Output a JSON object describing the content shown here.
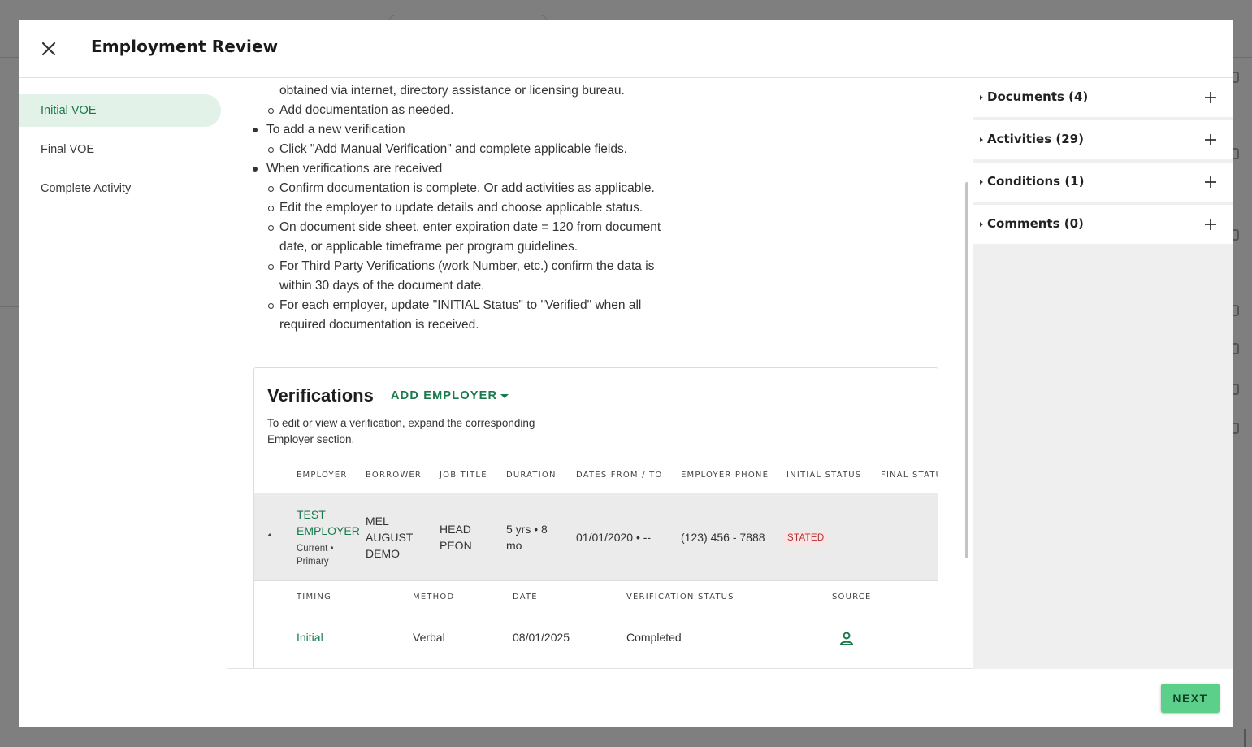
{
  "modal": {
    "title": "Employment Review",
    "close_icon": "close-icon"
  },
  "nav": {
    "items": [
      {
        "label": "Initial VOE",
        "active": true
      },
      {
        "label": "Final VOE",
        "active": false
      },
      {
        "label": "Complete Activity",
        "active": false
      }
    ]
  },
  "instructions": {
    "lines": [
      "obtained via internet, directory assistance or licensing bureau.",
      "Add documentation as needed.",
      "To add a new verification",
      "Click \"Add Manual Verification\" and complete applicable fields.",
      "When verifications are received",
      "Confirm documentation is complete. Or add activities as applicable.",
      "Edit the employer to update details and choose applicable status.",
      "On document side sheet, enter expiration date = 120 from document",
      "date, or applicable timeframe per program guidelines.",
      "For Third Party Verifications (work Number, etc.) confirm the data is",
      "within 30 days of the document date.",
      "For each employer, update \"INITIAL Status\" to \"Verified\" when all",
      "required documentation is received."
    ]
  },
  "verifications": {
    "title": "Verifications",
    "add_employer": "ADD EMPLOYER",
    "description": "To edit or view a verification, expand the corresponding Employer section.",
    "columns": [
      "EMPLOYER",
      "BORROWER",
      "JOB TITLE",
      "DURATION",
      "DATES FROM / TO",
      "EMPLOYER PHONE",
      "INITIAL STATUS",
      "FINAL STATU"
    ],
    "row": {
      "employer_l1": "TEST",
      "employer_l2": "EMPLOYER",
      "employer_sub_l1": "Current •",
      "employer_sub_l2": "Primary",
      "borrower_l1": "MEL",
      "borrower_l2": "AUGUST",
      "borrower_l3": "DEMO",
      "job_l1": "HEAD",
      "job_l2": "PEON",
      "duration_l1": "5 yrs • 8",
      "duration_l2": "mo",
      "dates": "01/01/2020 • --",
      "phone": "(123) 456 - 7888",
      "initial_status": "STATED"
    },
    "sub_columns": [
      "TIMING",
      "METHOD",
      "DATE",
      "VERIFICATION STATUS",
      "SOURCE"
    ],
    "sub_row": {
      "timing": "Initial",
      "method": "Verbal",
      "date": "08/01/2025",
      "status": "Completed",
      "source_icon": "person-icon"
    }
  },
  "sidebar": {
    "sections": [
      {
        "label": "Documents (4)"
      },
      {
        "label": "Activities (29)"
      },
      {
        "label": "Conditions (1)"
      },
      {
        "label": "Comments (0)"
      }
    ]
  },
  "footer": {
    "next_label": "NEXT"
  },
  "colors": {
    "accent": "#1a7a4c",
    "active_nav_bg": "#e3f2e9",
    "next_button": "#5ccf8b",
    "badge_bg": "#fbe4e4"
  }
}
